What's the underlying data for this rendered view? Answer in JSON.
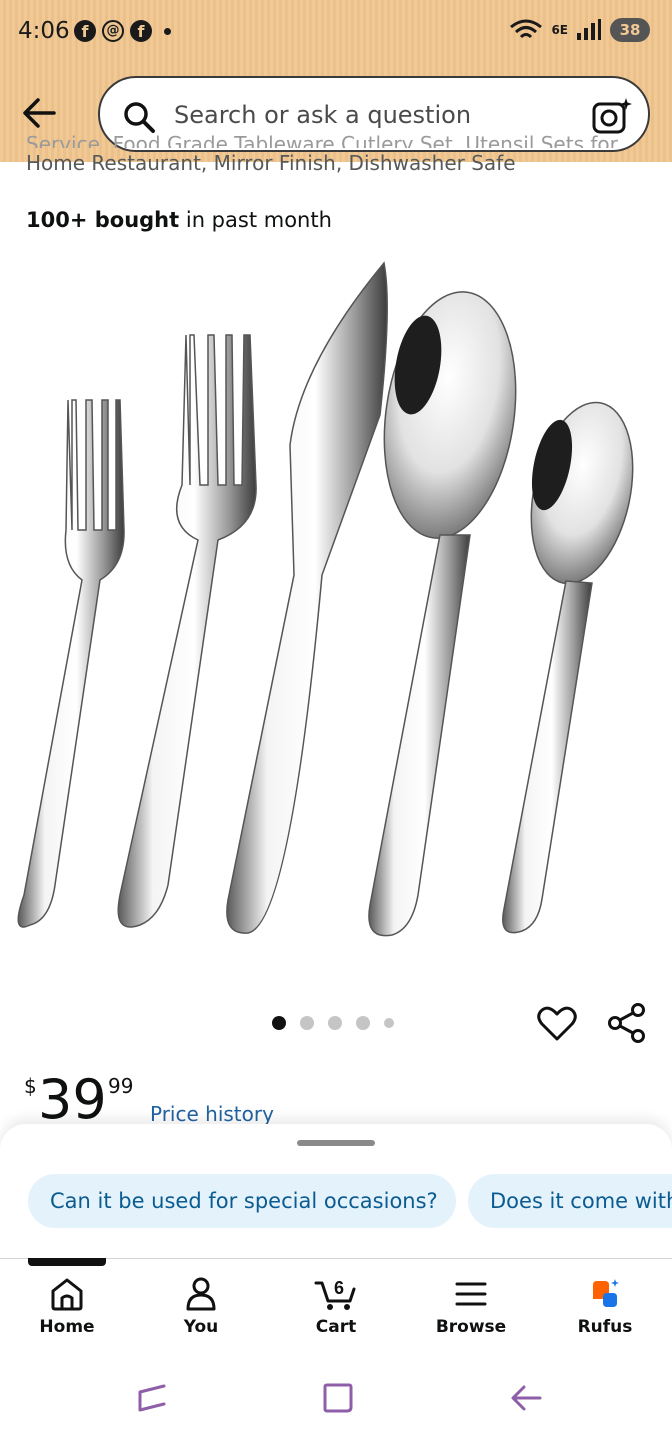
{
  "status_bar": {
    "time": "4:06",
    "network": "6E",
    "battery": "38"
  },
  "header": {
    "search_placeholder": "Search or ask a question"
  },
  "product": {
    "title_line_clipped": "Service, Food Grade Tableware Cutlery Set, Utensil Sets for",
    "title_line_2": "Home Restaurant, Mirror Finish, Dishwasher Safe",
    "bought_bold": "100+ bought",
    "bought_rest": " in past month",
    "image_count": 5,
    "active_image": 1,
    "price": {
      "currency": "$",
      "whole": "39",
      "fraction": "99"
    },
    "price_history_link": "Price history"
  },
  "suggestions": [
    "Can it be used for special occasions?",
    "Does it come with"
  ],
  "bottom_nav": {
    "items": [
      {
        "label": "Home",
        "icon": "home-icon"
      },
      {
        "label": "You",
        "icon": "person-icon"
      },
      {
        "label": "Cart",
        "icon": "cart-icon",
        "badge": "6"
      },
      {
        "label": "Browse",
        "icon": "menu-icon"
      },
      {
        "label": "Rufus",
        "icon": "rufus-icon"
      }
    ],
    "active": "Home"
  },
  "colors": {
    "header_bg": "#f0c995",
    "link": "#2162a1",
    "chip_bg": "#e3f2fb",
    "chip_text": "#0b5b91",
    "system_nav": "#8e5ea8"
  }
}
